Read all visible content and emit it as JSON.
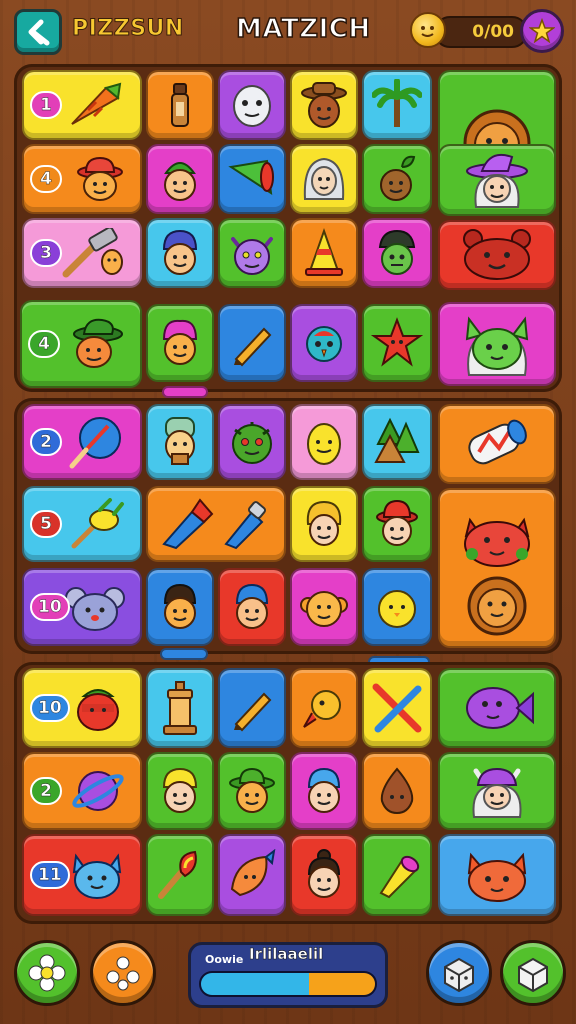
{
  "header": {
    "game_title": "PIZZSUN",
    "level_title": "MATZICH",
    "coins": "0/00"
  },
  "colors": {
    "yellow": "#f9e22c",
    "orange": "#f58a1c",
    "purple": "#a94ee0",
    "magenta": "#e43fc8",
    "blue": "#2e86e0",
    "cyan": "#47c7ec",
    "green": "#53c12c",
    "red": "#e8382a",
    "pink": "#f59ad8",
    "badge_pink": "#e23fb8",
    "badge_purple": "#8a3fd8",
    "badge_blue": "#2f6bd8",
    "badge_orange": "#f08a1a",
    "badge_red": "#d8322a",
    "badge_green": "#3aa62a"
  },
  "badges": {
    "s1r1": "1",
    "s1r2": "4",
    "s1r3": "3",
    "s1r4": "4",
    "s2r1": "2",
    "s2r2": "5",
    "s2r3": "10",
    "s3r1": "10",
    "s3r2": "2",
    "s3r3": "11"
  },
  "tiles": [
    {
      "icon": "carrot-icon"
    },
    {
      "icon": "bottle-icon"
    },
    {
      "icon": "ghost-face-icon"
    },
    {
      "icon": "cowboy-face-icon"
    },
    {
      "icon": "palm-tree-icon"
    },
    {
      "icon": "lion-face-icon"
    },
    {
      "icon": "hat-face-icon"
    },
    {
      "icon": "elf-face-icon"
    },
    {
      "icon": "cone-icon"
    },
    {
      "icon": "old-woman-icon"
    },
    {
      "icon": "plant-face-icon"
    },
    {
      "icon": "witch-face-icon"
    },
    {
      "icon": "hammer-icon"
    },
    {
      "icon": "boy-face-icon"
    },
    {
      "icon": "monster-face-icon"
    },
    {
      "icon": "traffic-cone-icon"
    },
    {
      "icon": "zombie-face-icon"
    },
    {
      "icon": "bear-face-icon"
    },
    {
      "icon": "hat-face-icon"
    },
    {
      "icon": "girl-face-icon"
    },
    {
      "icon": "pencil-icon"
    },
    {
      "icon": "bird-icon"
    },
    {
      "icon": "starfish-icon"
    },
    {
      "icon": "cat-face-icon"
    }
  ],
  "bottom_bar": {
    "progress_label": "Oowie",
    "progress_title": "Irlilaaelil",
    "progress_blue": 0.62,
    "progress_orange": 0.38
  }
}
